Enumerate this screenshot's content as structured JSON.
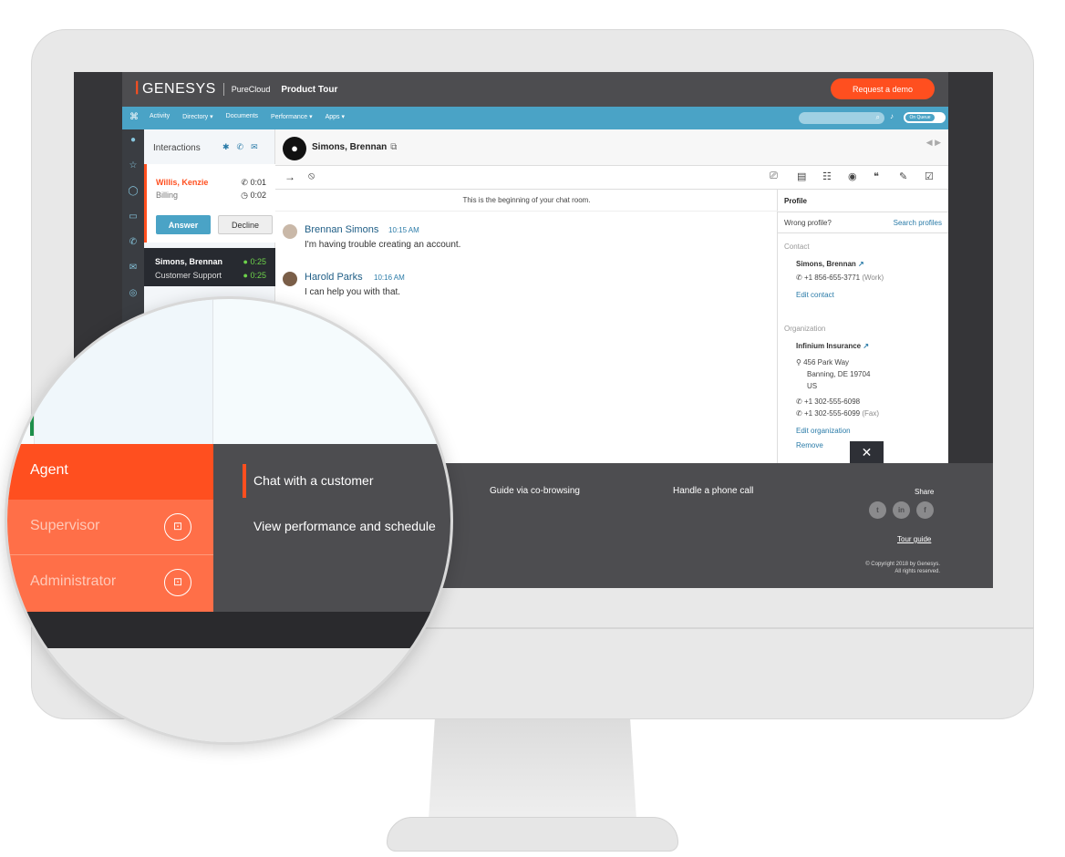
{
  "header": {
    "brand": "GENESYS",
    "product": "PureCloud",
    "tour_label": "Product Tour",
    "demo_button": "Request a demo"
  },
  "nav": {
    "items": [
      "Activity",
      "Directory ▾",
      "Documents",
      "Performance ▾",
      "Apps ▾"
    ],
    "status_toggle": "On Queue"
  },
  "interactions": {
    "title": "Interactions",
    "incoming": {
      "name": "Willis, Kenzie",
      "queue": "Billing",
      "time1": "0:01",
      "time2": "0:02",
      "answer": "Answer",
      "decline": "Decline"
    },
    "active": {
      "name": "Simons, Brennan",
      "queue": "Customer Support",
      "time1": "0:25",
      "time2": "0:25"
    }
  },
  "chat": {
    "contact": "Simons, Brennan",
    "beginning": "This is the beginning of your chat room.",
    "messages": [
      {
        "author": "Brennan Simons",
        "time": "10:15 AM",
        "text": "I'm having trouble creating an account."
      },
      {
        "author": "Harold Parks",
        "time": "10:16 AM",
        "text": "I can help you with that."
      }
    ]
  },
  "profile": {
    "title": "Profile",
    "wrong_profile": "Wrong profile?",
    "search_profiles": "Search profiles",
    "contact_label": "Contact",
    "contact_name": "Simons, Brennan",
    "contact_phone": "+1 856-655-3771",
    "contact_phone_type": "(Work)",
    "edit_contact": "Edit contact",
    "org_label": "Organization",
    "org_name": "Infinium Insurance",
    "addr1": "456 Park Way",
    "addr2": "Banning, DE 19704",
    "addr3": "US",
    "org_phone": "+1 302-555-6098",
    "org_fax": "+1 302-555-6099",
    "org_fax_type": "(Fax)",
    "edit_org": "Edit organization",
    "remove": "Remove"
  },
  "tour": {
    "tabs": [
      "Guide via co-browsing",
      "Handle a phone call"
    ],
    "share": "Share",
    "tour_guide": "Tour guide",
    "copyright_line1": "© Copyright 2018 by Genesys.",
    "copyright_line2": "All rights reserved."
  },
  "magnifier": {
    "roles": {
      "agent": "Agent",
      "supervisor": "Supervisor",
      "administrator": "Administrator"
    },
    "topics": {
      "chat": "Chat with a customer",
      "performance": "View performance and schedule"
    }
  },
  "colors": {
    "brand_orange": "#ff4f1f",
    "nav_blue": "#4aa3c6",
    "header_grey": "#4d4d50"
  }
}
